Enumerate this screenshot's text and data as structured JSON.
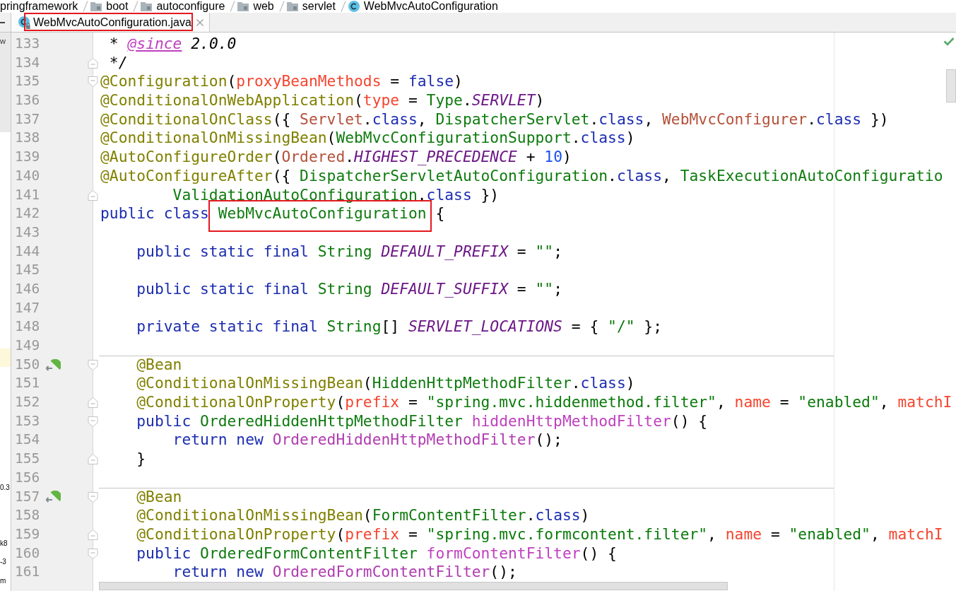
{
  "breadcrumbs": [
    {
      "text": "pringframework",
      "kind": "fragment"
    },
    {
      "text": "boot",
      "kind": "package"
    },
    {
      "text": "autoconfigure",
      "kind": "package"
    },
    {
      "text": "web",
      "kind": "package"
    },
    {
      "text": "servlet",
      "kind": "package"
    },
    {
      "text": "WebMvcAutoConfiguration",
      "kind": "class"
    }
  ],
  "tabs": [
    {
      "label": "WebMvcAutoConfiguration.java",
      "selected": true,
      "framed": true
    }
  ],
  "project_panel": {
    "upper_text": "w",
    "rows": [
      {
        "selected": true
      },
      {
        "selected": false
      },
      {
        "selected": false
      },
      {
        "selected": false
      },
      {
        "selected": false
      },
      {
        "selected": false
      },
      {
        "selected": false
      },
      {
        "text": "0.3",
        "selected": false
      },
      {
        "selected": false
      },
      {
        "selected": false
      },
      {
        "text": "k8",
        "selected": false
      },
      {
        "text": "-3",
        "selected": false
      },
      {
        "text": "m",
        "selected": false
      }
    ]
  },
  "editor": {
    "lines": [
      {
        "number": "133",
        "separator_above": false,
        "tokens": [
          {
            "text": " * ",
            "kind": "doc"
          },
          {
            "text": "@since",
            "kind": "doc_tag"
          },
          {
            "text": " 2.0.0",
            "kind": "doc"
          }
        ]
      },
      {
        "number": "134",
        "separator_above": false,
        "gutter_icons": [
          {
            "kind": "fold_end"
          }
        ],
        "tokens": [
          {
            "text": " */",
            "kind": "doc"
          }
        ]
      },
      {
        "number": "135",
        "separator_above": false,
        "gutter_icons": [
          {
            "kind": "fold_start"
          }
        ],
        "tokens": [
          {
            "text": "@Configuration",
            "kind": "annotation"
          },
          {
            "text": "(",
            "kind": "plain"
          },
          {
            "text": "proxyBeanMethods",
            "kind": "attr"
          },
          {
            "text": " = ",
            "kind": "plain"
          },
          {
            "text": "false",
            "kind": "keyword"
          },
          {
            "text": ")",
            "kind": "plain"
          }
        ]
      },
      {
        "number": "136",
        "separator_above": false,
        "tokens": [
          {
            "text": "@ConditionalOnWebApplication",
            "kind": "annotation"
          },
          {
            "text": "(",
            "kind": "plain"
          },
          {
            "text": "type",
            "kind": "attr"
          },
          {
            "text": " = ",
            "kind": "plain"
          },
          {
            "text": "Type",
            "kind": "type"
          },
          {
            "text": ".",
            "kind": "plain"
          },
          {
            "text": "SERVLET",
            "kind": "constant"
          },
          {
            "text": ")",
            "kind": "plain"
          }
        ]
      },
      {
        "number": "137",
        "separator_above": false,
        "tokens": [
          {
            "text": "@ConditionalOnClass",
            "kind": "annotation"
          },
          {
            "text": "({ ",
            "kind": "plain"
          },
          {
            "text": "Servlet",
            "kind": "class_ref"
          },
          {
            "text": ".",
            "kind": "plain"
          },
          {
            "text": "class",
            "kind": "keyword"
          },
          {
            "text": ", ",
            "kind": "plain"
          },
          {
            "text": "DispatcherServlet",
            "kind": "type"
          },
          {
            "text": ".",
            "kind": "plain"
          },
          {
            "text": "class",
            "kind": "keyword"
          },
          {
            "text": ", ",
            "kind": "plain"
          },
          {
            "text": "WebMvcConfigurer",
            "kind": "class_ref"
          },
          {
            "text": ".",
            "kind": "plain"
          },
          {
            "text": "class",
            "kind": "keyword"
          },
          {
            "text": " })",
            "kind": "plain"
          }
        ]
      },
      {
        "number": "138",
        "separator_above": false,
        "tokens": [
          {
            "text": "@ConditionalOnMissingBean",
            "kind": "annotation"
          },
          {
            "text": "(",
            "kind": "plain"
          },
          {
            "text": "WebMvcConfigurationSupport",
            "kind": "type"
          },
          {
            "text": ".",
            "kind": "plain"
          },
          {
            "text": "class",
            "kind": "keyword"
          },
          {
            "text": ")",
            "kind": "plain"
          }
        ]
      },
      {
        "number": "139",
        "separator_above": false,
        "tokens": [
          {
            "text": "@AutoConfigureOrder",
            "kind": "annotation"
          },
          {
            "text": "(",
            "kind": "plain"
          },
          {
            "text": "Ordered",
            "kind": "class_ref"
          },
          {
            "text": ".",
            "kind": "plain"
          },
          {
            "text": "HIGHEST_PRECEDENCE",
            "kind": "constant"
          },
          {
            "text": " + ",
            "kind": "plain"
          },
          {
            "text": "10",
            "kind": "number"
          },
          {
            "text": ")",
            "kind": "plain"
          }
        ]
      },
      {
        "number": "140",
        "separator_above": false,
        "tokens": [
          {
            "text": "@AutoConfigureAfter",
            "kind": "annotation"
          },
          {
            "text": "({ ",
            "kind": "plain"
          },
          {
            "text": "DispatcherServletAutoConfiguration",
            "kind": "type"
          },
          {
            "text": ".",
            "kind": "plain"
          },
          {
            "text": "class",
            "kind": "keyword"
          },
          {
            "text": ", ",
            "kind": "plain"
          },
          {
            "text": "TaskExecutionAutoConfiguratio",
            "kind": "type"
          }
        ]
      },
      {
        "number": "141",
        "separator_above": false,
        "gutter_icons": [
          {
            "kind": "fold_end"
          }
        ],
        "tokens": [
          {
            "text": "        ValidationAutoConfiguration",
            "kind": "type"
          },
          {
            "text": ".",
            "kind": "plain"
          },
          {
            "text": "class",
            "kind": "keyword"
          },
          {
            "text": " })",
            "kind": "plain"
          }
        ]
      },
      {
        "number": "142",
        "separator_above": false,
        "tokens": [
          {
            "text": "public class ",
            "kind": "keyword"
          },
          {
            "text": "WebMvcAutoConfiguration",
            "kind": "type",
            "framed": true
          },
          {
            "text": " {",
            "kind": "plain"
          }
        ]
      },
      {
        "number": "143",
        "separator_above": false
      },
      {
        "number": "144",
        "separator_above": false,
        "tokens": [
          {
            "text": "    public static final ",
            "kind": "keyword"
          },
          {
            "text": "String ",
            "kind": "type"
          },
          {
            "text": "DEFAULT_PREFIX",
            "kind": "constant"
          },
          {
            "text": " = ",
            "kind": "plain"
          },
          {
            "text": "\"\"",
            "kind": "string"
          },
          {
            "text": ";",
            "kind": "plain"
          }
        ]
      },
      {
        "number": "145",
        "separator_above": false
      },
      {
        "number": "146",
        "separator_above": false,
        "tokens": [
          {
            "text": "    public static final ",
            "kind": "keyword"
          },
          {
            "text": "String ",
            "kind": "type"
          },
          {
            "text": "DEFAULT_SUFFIX",
            "kind": "constant"
          },
          {
            "text": " = ",
            "kind": "plain"
          },
          {
            "text": "\"\"",
            "kind": "string"
          },
          {
            "text": ";",
            "kind": "plain"
          }
        ]
      },
      {
        "number": "147",
        "separator_above": false
      },
      {
        "number": "148",
        "separator_above": false,
        "tokens": [
          {
            "text": "    private static final ",
            "kind": "keyword"
          },
          {
            "text": "String",
            "kind": "type"
          },
          {
            "text": "[] ",
            "kind": "plain"
          },
          {
            "text": "SERVLET_LOCATIONS",
            "kind": "constant"
          },
          {
            "text": " = { ",
            "kind": "plain"
          },
          {
            "text": "\"/\"",
            "kind": "string"
          },
          {
            "text": " };",
            "kind": "plain"
          }
        ]
      },
      {
        "number": "149",
        "separator_above": false
      },
      {
        "number": "150",
        "separator_above": true,
        "gutter_icons": [
          {
            "kind": "bean"
          },
          {
            "kind": "fold_start"
          }
        ],
        "tokens": [
          {
            "text": "    @Bean",
            "kind": "annotation"
          }
        ]
      },
      {
        "number": "151",
        "separator_above": false,
        "tokens": [
          {
            "text": "    @ConditionalOnMissingBean",
            "kind": "annotation"
          },
          {
            "text": "(",
            "kind": "plain"
          },
          {
            "text": "HiddenHttpMethodFilter",
            "kind": "type"
          },
          {
            "text": ".",
            "kind": "plain"
          },
          {
            "text": "class",
            "kind": "keyword"
          },
          {
            "text": ")",
            "kind": "plain"
          }
        ]
      },
      {
        "number": "152",
        "separator_above": false,
        "gutter_icons": [
          {
            "kind": "fold_end"
          }
        ],
        "tokens": [
          {
            "text": "    @ConditionalOnProperty",
            "kind": "annotation"
          },
          {
            "text": "(",
            "kind": "plain"
          },
          {
            "text": "prefix",
            "kind": "attr"
          },
          {
            "text": " = ",
            "kind": "plain"
          },
          {
            "text": "\"spring.mvc.hiddenmethod.filter\"",
            "kind": "string"
          },
          {
            "text": ", ",
            "kind": "plain"
          },
          {
            "text": "name",
            "kind": "attr"
          },
          {
            "text": " = ",
            "kind": "plain"
          },
          {
            "text": "\"enabled\"",
            "kind": "string"
          },
          {
            "text": ", ",
            "kind": "plain"
          },
          {
            "text": "matchI",
            "kind": "attr"
          }
        ]
      },
      {
        "number": "153",
        "separator_above": false,
        "gutter_icons": [
          {
            "kind": "fold_start"
          }
        ],
        "tokens": [
          {
            "text": "    public ",
            "kind": "keyword"
          },
          {
            "text": "OrderedHiddenHttpMethodFilter ",
            "kind": "type"
          },
          {
            "text": "hiddenHttpMethodFilter",
            "kind": "method"
          },
          {
            "text": "() {",
            "kind": "plain"
          }
        ]
      },
      {
        "number": "154",
        "separator_above": false,
        "tokens": [
          {
            "text": "        return new ",
            "kind": "keyword"
          },
          {
            "text": "OrderedHiddenHttpMethodFilter",
            "kind": "constructor"
          },
          {
            "text": "();",
            "kind": "plain"
          }
        ]
      },
      {
        "number": "155",
        "separator_above": false,
        "gutter_icons": [
          {
            "kind": "fold_end"
          }
        ],
        "tokens": [
          {
            "text": "    }",
            "kind": "plain"
          }
        ]
      },
      {
        "number": "156",
        "separator_above": false
      },
      {
        "number": "157",
        "separator_above": true,
        "gutter_icons": [
          {
            "kind": "bean"
          },
          {
            "kind": "fold_start"
          }
        ],
        "tokens": [
          {
            "text": "    @Bean",
            "kind": "annotation"
          }
        ]
      },
      {
        "number": "158",
        "separator_above": false,
        "tokens": [
          {
            "text": "    @ConditionalOnMissingBean",
            "kind": "annotation"
          },
          {
            "text": "(",
            "kind": "plain"
          },
          {
            "text": "FormContentFilter",
            "kind": "type"
          },
          {
            "text": ".",
            "kind": "plain"
          },
          {
            "text": "class",
            "kind": "keyword"
          },
          {
            "text": ")",
            "kind": "plain"
          }
        ]
      },
      {
        "number": "159",
        "separator_above": false,
        "gutter_icons": [
          {
            "kind": "fold_end"
          }
        ],
        "tokens": [
          {
            "text": "    @ConditionalOnProperty",
            "kind": "annotation"
          },
          {
            "text": "(",
            "kind": "plain"
          },
          {
            "text": "prefix",
            "kind": "attr"
          },
          {
            "text": " = ",
            "kind": "plain"
          },
          {
            "text": "\"spring.mvc.formcontent.filter\"",
            "kind": "string"
          },
          {
            "text": ", ",
            "kind": "plain"
          },
          {
            "text": "name",
            "kind": "attr"
          },
          {
            "text": " = ",
            "kind": "plain"
          },
          {
            "text": "\"enabled\"",
            "kind": "string"
          },
          {
            "text": ", ",
            "kind": "plain"
          },
          {
            "text": "matchI",
            "kind": "attr"
          }
        ]
      },
      {
        "number": "160",
        "separator_above": false,
        "gutter_icons": [
          {
            "kind": "fold_start"
          }
        ],
        "tokens": [
          {
            "text": "    public ",
            "kind": "keyword"
          },
          {
            "text": "OrderedFormContentFilter ",
            "kind": "type"
          },
          {
            "text": "formContentFilter",
            "kind": "method"
          },
          {
            "text": "() {",
            "kind": "plain"
          }
        ]
      },
      {
        "number": "161",
        "separator_above": false,
        "tokens": [
          {
            "text": "        return new ",
            "kind": "keyword"
          },
          {
            "text": "OrderedFormContentFilter",
            "kind": "constructor"
          },
          {
            "text": "();",
            "kind": "plain"
          }
        ]
      }
    ]
  }
}
